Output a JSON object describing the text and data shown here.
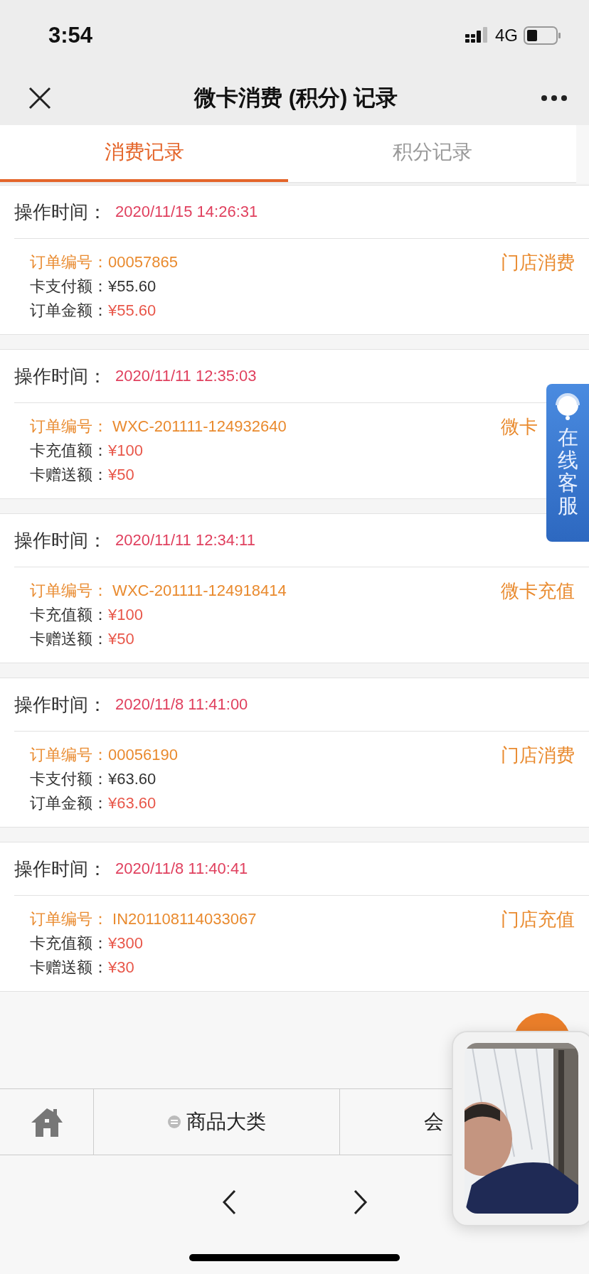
{
  "status_bar": {
    "time": "3:54",
    "network": "4G"
  },
  "nav": {
    "title": "微卡消费 (积分) 记录"
  },
  "tabs": [
    {
      "label": "消费记录",
      "selected": true
    },
    {
      "label": "积分记录",
      "selected": false
    }
  ],
  "records": [
    {
      "time_label": "操作时间：",
      "time": "2020/11/15 14:26:31",
      "type": "门店消费",
      "lines": [
        {
          "kind": "order",
          "label": "订单编号：",
          "value": "00057865"
        },
        {
          "kind": "plain",
          "label": "卡支付额：",
          "value": "¥55.60"
        },
        {
          "kind": "amount",
          "label": "订单金额：",
          "value": "¥55.60"
        }
      ]
    },
    {
      "time_label": "操作时间：",
      "time": "2020/11/11 12:35:03",
      "type": "微卡",
      "lines": [
        {
          "kind": "order",
          "label": "订单编号：",
          "value": "WXC-201111-124932640"
        },
        {
          "kind": "amount",
          "label": "卡充值额：",
          "value": "¥100"
        },
        {
          "kind": "amount",
          "label": "卡赠送额：",
          "value": "¥50"
        }
      ]
    },
    {
      "time_label": "操作时间：",
      "time": "2020/11/11 12:34:11",
      "type": "微卡充值",
      "lines": [
        {
          "kind": "order",
          "label": "订单编号：",
          "value": "WXC-201111-124918414"
        },
        {
          "kind": "amount",
          "label": "卡充值额：",
          "value": "¥100"
        },
        {
          "kind": "amount",
          "label": "卡赠送额：",
          "value": "¥50"
        }
      ]
    },
    {
      "time_label": "操作时间：",
      "time": "2020/11/8 11:41:00",
      "type": "门店消费",
      "lines": [
        {
          "kind": "order",
          "label": "订单编号：",
          "value": "00056190"
        },
        {
          "kind": "plain",
          "label": "卡支付额：",
          "value": "¥63.60"
        },
        {
          "kind": "amount",
          "label": "订单金额：",
          "value": "¥63.60"
        }
      ]
    },
    {
      "time_label": "操作时间：",
      "time": "2020/11/8 11:40:41",
      "type": "门店充值",
      "lines": [
        {
          "kind": "order",
          "label": "订单编号：",
          "value": "IN201108114033067"
        },
        {
          "kind": "amount",
          "label": "卡充值额：",
          "value": "¥300"
        },
        {
          "kind": "amount",
          "label": "卡赠送额：",
          "value": "¥30"
        }
      ]
    }
  ],
  "service_tab": {
    "label": "在线客服"
  },
  "bottom_nav": [
    {
      "kind": "home"
    },
    {
      "kind": "menu",
      "label": "商品大类"
    },
    {
      "kind": "text",
      "label": "会"
    }
  ]
}
